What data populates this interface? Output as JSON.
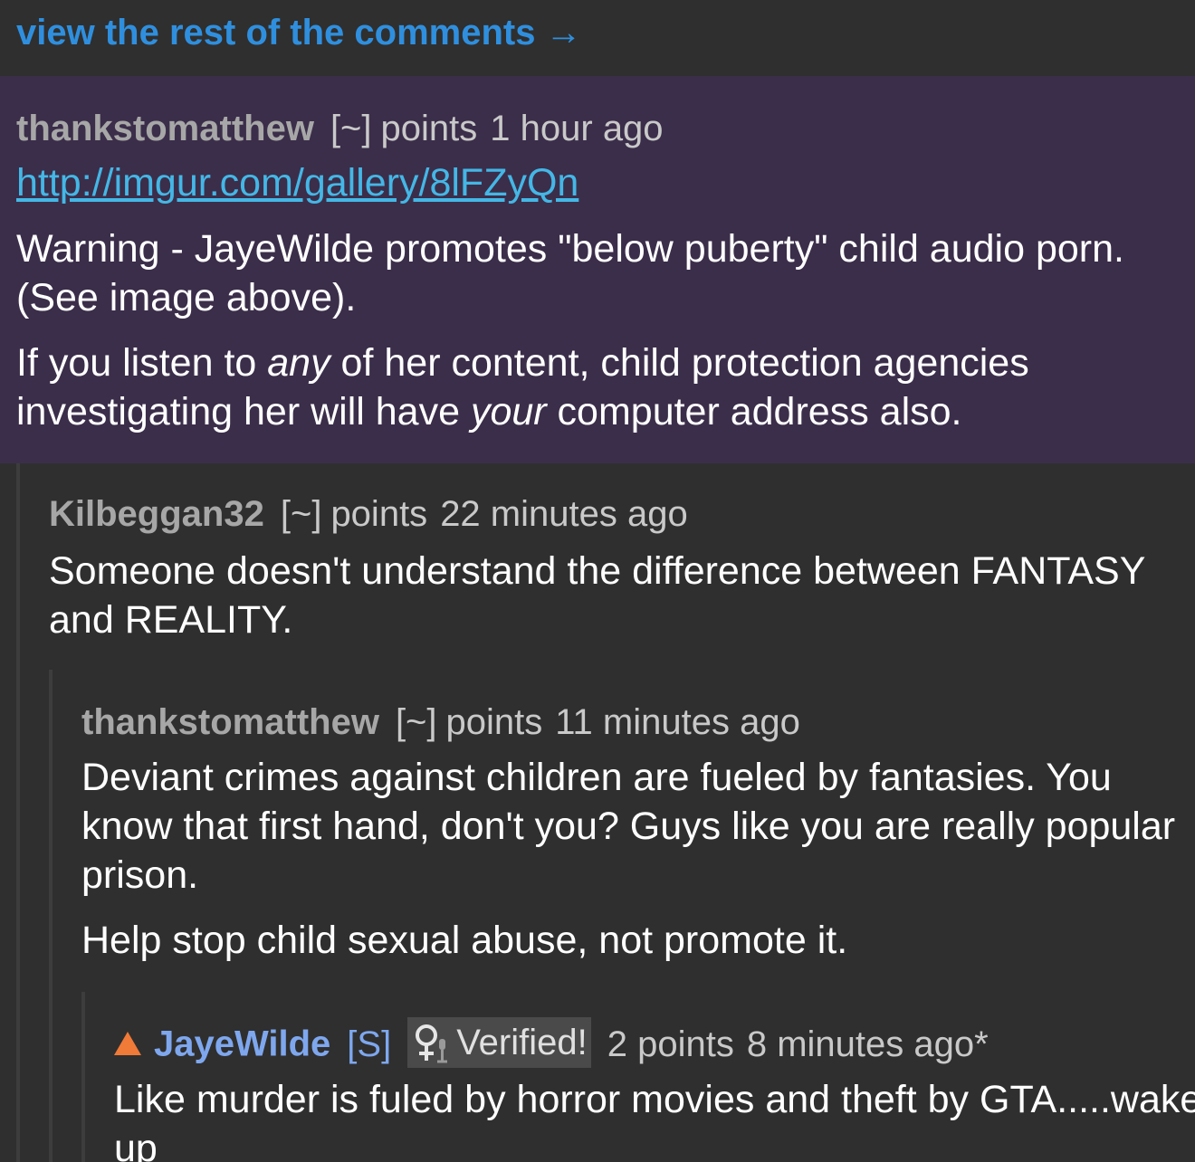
{
  "top_link": {
    "label": "view the rest of the comments →"
  },
  "comments": [
    {
      "author": "thankstomatthew",
      "score_bracket": "[~]",
      "points_label": "points",
      "time": "1 hour ago",
      "link": "http://imgur.com/gallery/8lFZyQn",
      "paragraph_1_lines": [
        "Warning - JayeWilde promotes \"below puberty\" child audio porn.",
        "(See image above)."
      ],
      "paragraph_2": {
        "line1_a": "If you listen to ",
        "line1_em": "any",
        "line1_b": " of her content, child protection agencies",
        "line2_a": "investigating her will have ",
        "line2_em": "your",
        "line2_b": " computer address also."
      }
    },
    {
      "author": "Kilbeggan32",
      "score_bracket": "[~]",
      "points_label": "points",
      "time": "22 minutes ago",
      "paragraph_1_lines": [
        "Someone doesn't understand the difference between FANTASY",
        "and REALITY."
      ]
    },
    {
      "author": "thankstomatthew",
      "score_bracket": "[~]",
      "points_label": "points",
      "time": "11 minutes ago",
      "paragraph_1_lines": [
        "Deviant crimes against children are fueled by fantasies. You",
        "know that first hand, don't you? Guys like you are really popular",
        "prison."
      ],
      "paragraph_2": "Help stop child sexual abuse, not promote it."
    },
    {
      "author": "JayeWilde",
      "submitter_tag": "[S]",
      "flair": "Verified!",
      "flair_icon": "female-microphone-icon",
      "points": "2 points",
      "time": "8 minutes ago*",
      "paragraph_1_lines": [
        "Like murder is fuled by horror movies and theft by GTA.....wake",
        "up"
      ]
    }
  ],
  "colors": {
    "background": "#2f2f2f",
    "highlight": "#3b2e4a",
    "link": "#2f8fde",
    "url": "#44b7e6",
    "op_author": "#7ea7ee",
    "upvote": "#f07a38"
  }
}
